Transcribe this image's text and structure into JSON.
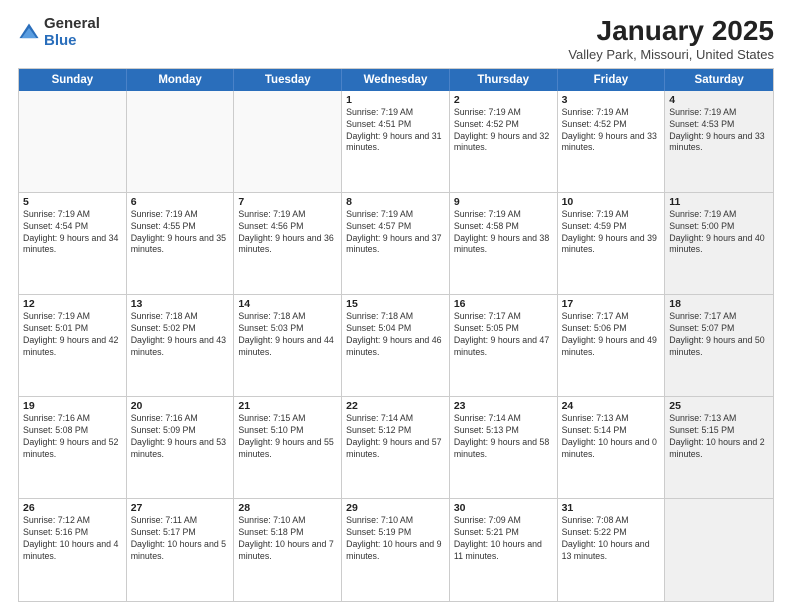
{
  "logo": {
    "general": "General",
    "blue": "Blue"
  },
  "header": {
    "title": "January 2025",
    "location": "Valley Park, Missouri, United States"
  },
  "days_of_week": [
    "Sunday",
    "Monday",
    "Tuesday",
    "Wednesday",
    "Thursday",
    "Friday",
    "Saturday"
  ],
  "weeks": [
    [
      {
        "day": "",
        "empty": true
      },
      {
        "day": "",
        "empty": true
      },
      {
        "day": "",
        "empty": true
      },
      {
        "day": "1",
        "sunrise": "7:19 AM",
        "sunset": "4:51 PM",
        "daylight": "9 hours and 31 minutes."
      },
      {
        "day": "2",
        "sunrise": "7:19 AM",
        "sunset": "4:52 PM",
        "daylight": "9 hours and 32 minutes."
      },
      {
        "day": "3",
        "sunrise": "7:19 AM",
        "sunset": "4:52 PM",
        "daylight": "9 hours and 33 minutes."
      },
      {
        "day": "4",
        "sunrise": "7:19 AM",
        "sunset": "4:53 PM",
        "daylight": "9 hours and 33 minutes.",
        "shaded": true
      }
    ],
    [
      {
        "day": "5",
        "sunrise": "7:19 AM",
        "sunset": "4:54 PM",
        "daylight": "9 hours and 34 minutes."
      },
      {
        "day": "6",
        "sunrise": "7:19 AM",
        "sunset": "4:55 PM",
        "daylight": "9 hours and 35 minutes."
      },
      {
        "day": "7",
        "sunrise": "7:19 AM",
        "sunset": "4:56 PM",
        "daylight": "9 hours and 36 minutes."
      },
      {
        "day": "8",
        "sunrise": "7:19 AM",
        "sunset": "4:57 PM",
        "daylight": "9 hours and 37 minutes."
      },
      {
        "day": "9",
        "sunrise": "7:19 AM",
        "sunset": "4:58 PM",
        "daylight": "9 hours and 38 minutes."
      },
      {
        "day": "10",
        "sunrise": "7:19 AM",
        "sunset": "4:59 PM",
        "daylight": "9 hours and 39 minutes."
      },
      {
        "day": "11",
        "sunrise": "7:19 AM",
        "sunset": "5:00 PM",
        "daylight": "9 hours and 40 minutes.",
        "shaded": true
      }
    ],
    [
      {
        "day": "12",
        "sunrise": "7:19 AM",
        "sunset": "5:01 PM",
        "daylight": "9 hours and 42 minutes."
      },
      {
        "day": "13",
        "sunrise": "7:18 AM",
        "sunset": "5:02 PM",
        "daylight": "9 hours and 43 minutes."
      },
      {
        "day": "14",
        "sunrise": "7:18 AM",
        "sunset": "5:03 PM",
        "daylight": "9 hours and 44 minutes."
      },
      {
        "day": "15",
        "sunrise": "7:18 AM",
        "sunset": "5:04 PM",
        "daylight": "9 hours and 46 minutes."
      },
      {
        "day": "16",
        "sunrise": "7:17 AM",
        "sunset": "5:05 PM",
        "daylight": "9 hours and 47 minutes."
      },
      {
        "day": "17",
        "sunrise": "7:17 AM",
        "sunset": "5:06 PM",
        "daylight": "9 hours and 49 minutes."
      },
      {
        "day": "18",
        "sunrise": "7:17 AM",
        "sunset": "5:07 PM",
        "daylight": "9 hours and 50 minutes.",
        "shaded": true
      }
    ],
    [
      {
        "day": "19",
        "sunrise": "7:16 AM",
        "sunset": "5:08 PM",
        "daylight": "9 hours and 52 minutes."
      },
      {
        "day": "20",
        "sunrise": "7:16 AM",
        "sunset": "5:09 PM",
        "daylight": "9 hours and 53 minutes."
      },
      {
        "day": "21",
        "sunrise": "7:15 AM",
        "sunset": "5:10 PM",
        "daylight": "9 hours and 55 minutes."
      },
      {
        "day": "22",
        "sunrise": "7:14 AM",
        "sunset": "5:12 PM",
        "daylight": "9 hours and 57 minutes."
      },
      {
        "day": "23",
        "sunrise": "7:14 AM",
        "sunset": "5:13 PM",
        "daylight": "9 hours and 58 minutes."
      },
      {
        "day": "24",
        "sunrise": "7:13 AM",
        "sunset": "5:14 PM",
        "daylight": "10 hours and 0 minutes."
      },
      {
        "day": "25",
        "sunrise": "7:13 AM",
        "sunset": "5:15 PM",
        "daylight": "10 hours and 2 minutes.",
        "shaded": true
      }
    ],
    [
      {
        "day": "26",
        "sunrise": "7:12 AM",
        "sunset": "5:16 PM",
        "daylight": "10 hours and 4 minutes."
      },
      {
        "day": "27",
        "sunrise": "7:11 AM",
        "sunset": "5:17 PM",
        "daylight": "10 hours and 5 minutes."
      },
      {
        "day": "28",
        "sunrise": "7:10 AM",
        "sunset": "5:18 PM",
        "daylight": "10 hours and 7 minutes."
      },
      {
        "day": "29",
        "sunrise": "7:10 AM",
        "sunset": "5:19 PM",
        "daylight": "10 hours and 9 minutes."
      },
      {
        "day": "30",
        "sunrise": "7:09 AM",
        "sunset": "5:21 PM",
        "daylight": "10 hours and 11 minutes."
      },
      {
        "day": "31",
        "sunrise": "7:08 AM",
        "sunset": "5:22 PM",
        "daylight": "10 hours and 13 minutes."
      },
      {
        "day": "",
        "empty": true,
        "shaded": true
      }
    ]
  ]
}
